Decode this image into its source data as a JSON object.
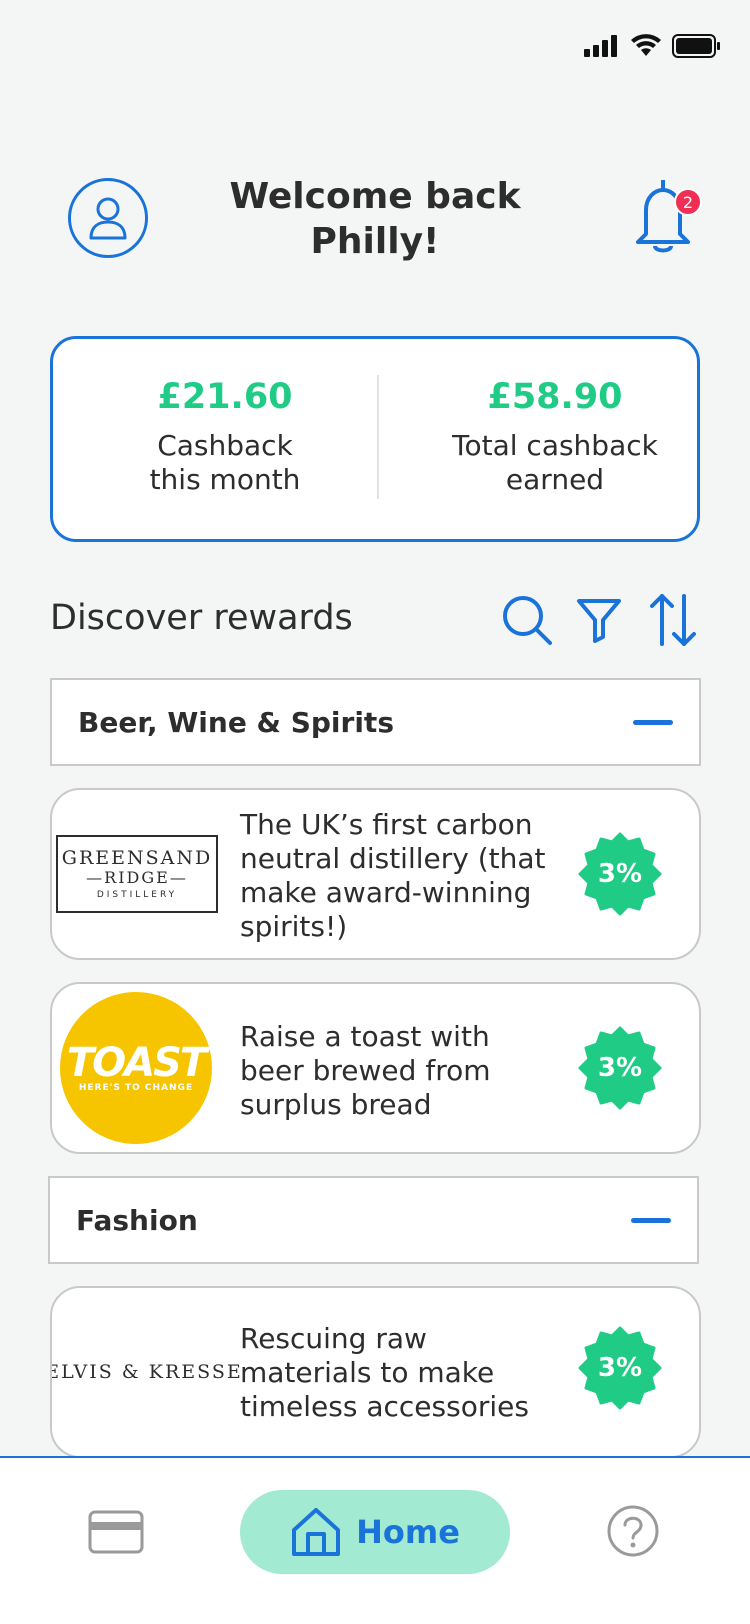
{
  "header": {
    "welcome": "Welcome back Philly!",
    "notification_count": "2"
  },
  "cashback": {
    "month_amount": "£21.60",
    "month_label": "Cashback this month",
    "total_amount": "£58.90",
    "total_label": "Total cashback earned"
  },
  "discover": {
    "title": "Discover rewards"
  },
  "categories": [
    {
      "label": "Beer, Wine & Spirits",
      "rewards": [
        {
          "logo_text": [
            "GREENSAND",
            "—RIDGE—",
            "DISTILLERY"
          ],
          "description": "The UK’s first carbon neutral distillery (that make award-winning spirits!)",
          "rate": "3%"
        },
        {
          "logo_text": [
            "TOAST",
            "HERE'S TO CHANGE"
          ],
          "description": "Raise a toast with beer brewed from surplus bread",
          "rate": "3%"
        }
      ]
    },
    {
      "label": "Fashion",
      "rewards": [
        {
          "logo_text": [
            "ELVIS & KRESSE"
          ],
          "description": "Rescuing raw materials to make timeless accessories",
          "rate": "3%"
        }
      ]
    }
  ],
  "nav": {
    "home_label": "Home"
  },
  "colors": {
    "accent": "#1a73d9",
    "green": "#1fcb85",
    "home_pill": "#a2ead2",
    "badge": "#ef2f53"
  }
}
